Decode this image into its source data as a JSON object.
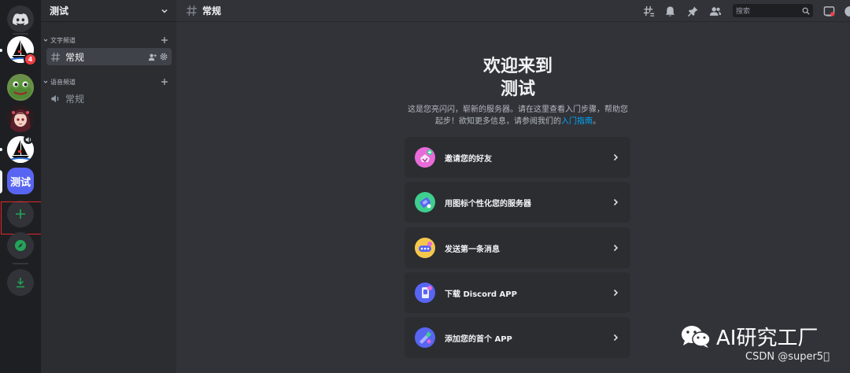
{
  "server_rail": {
    "badge_count": "4",
    "active_server_label": "测试"
  },
  "guild": {
    "name": "测试"
  },
  "categories": {
    "text_label": "文字频道",
    "voice_label": "语音频道"
  },
  "channels": {
    "text_channel": "常规",
    "voice_channel": "常规"
  },
  "topbar": {
    "channel_name": "常规",
    "search_placeholder": "搜索"
  },
  "welcome": {
    "title_line1": "欢迎来到",
    "title_line2": "测试",
    "desc_line1": "这是您亮闪闪，崭新的服务器。请在这里查看入门步骤，帮助您",
    "desc_line2_prefix": "起步！欲知更多信息，请参阅我们的",
    "desc_link": "入门指南",
    "desc_line2_suffix": "。"
  },
  "actions": [
    {
      "label": "邀请您的好友",
      "icon": "invite-friends-icon",
      "color": "#e76bd9"
    },
    {
      "label": "用图标个性化您的服务器",
      "icon": "personalize-icon",
      "color": "#3ecf8e"
    },
    {
      "label": "发送第一条消息",
      "icon": "send-message-icon",
      "color": "#f5c84b"
    },
    {
      "label": "下载 Discord APP",
      "icon": "download-app-icon",
      "color": "#5865f2"
    },
    {
      "label": "添加您的首个 APP",
      "icon": "add-app-icon",
      "color": "#5865f2"
    }
  ],
  "watermark": {
    "title": "AI研究工厂",
    "credit": "CSDN @super5\u0000"
  },
  "colors": {
    "rail_bg": "#1e1f22",
    "sidebar_bg": "#2b2d31",
    "main_bg": "#313338",
    "brand": "#5865f2",
    "green": "#23a559",
    "danger": "#f23f43",
    "link": "#00a8fc"
  }
}
